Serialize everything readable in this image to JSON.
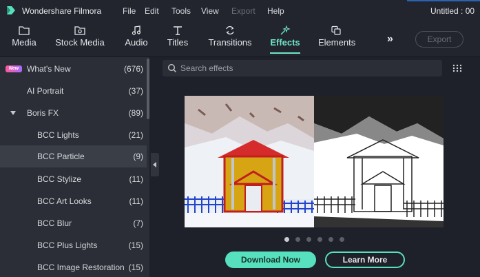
{
  "app": {
    "name": "Wondershare Filmora",
    "doc_title": "Untitled : 00"
  },
  "menu": [
    {
      "label": "File",
      "enabled": true
    },
    {
      "label": "Edit",
      "enabled": true
    },
    {
      "label": "Tools",
      "enabled": true
    },
    {
      "label": "View",
      "enabled": true
    },
    {
      "label": "Export",
      "enabled": false
    },
    {
      "label": "Help",
      "enabled": true
    }
  ],
  "toolbar": {
    "tabs": [
      {
        "label": "Media",
        "icon": "folder-icon"
      },
      {
        "label": "Stock Media",
        "icon": "image-icon"
      },
      {
        "label": "Audio",
        "icon": "music-note-icon"
      },
      {
        "label": "Titles",
        "icon": "text-t-icon"
      },
      {
        "label": "Transitions",
        "icon": "transitions-icon"
      },
      {
        "label": "Effects",
        "icon": "effects-icon",
        "active": true
      },
      {
        "label": "Elements",
        "icon": "elements-icon"
      }
    ],
    "more": "»",
    "export_label": "Export"
  },
  "sidebar": {
    "items": [
      {
        "label": "What's New",
        "count": "(676)",
        "badge": "New"
      },
      {
        "label": "AI Portrait",
        "count": "(37)"
      },
      {
        "label": "Boris FX",
        "count": "(89)",
        "expanded": true
      },
      {
        "label": "BCC Lights",
        "count": "(21)"
      },
      {
        "label": "BCC Particle",
        "count": "(9)",
        "selected": true
      },
      {
        "label": "BCC Stylize",
        "count": "(11)"
      },
      {
        "label": "BCC Art Looks",
        "count": "(11)"
      },
      {
        "label": "BCC Blur",
        "count": "(7)"
      },
      {
        "label": "BCC Plus Lights",
        "count": "(15)"
      },
      {
        "label": "BCC Image Restoration",
        "count": "(15)"
      }
    ]
  },
  "search": {
    "placeholder": "Search effects",
    "value": ""
  },
  "banner": {
    "carousel_pages": 6,
    "active_page": 1,
    "download_label": "Download Now",
    "learn_label": "Learn More"
  },
  "colors": {
    "accent": "#56e0bd",
    "background": "#1e2129",
    "sidebar": "#2b2e36"
  }
}
